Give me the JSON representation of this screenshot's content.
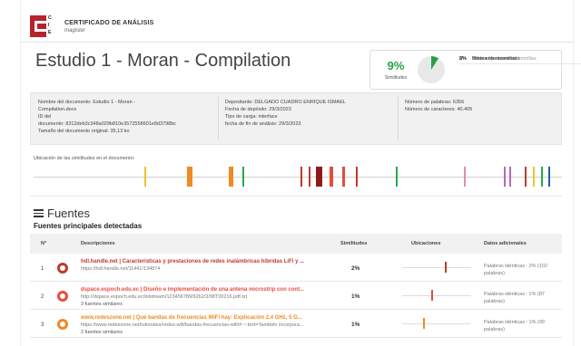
{
  "header": {
    "logo_letters": [
      "C",
      "I",
      "E"
    ],
    "title": "CERTIFICADO DE ANÁLISIS",
    "subtitle": "magister"
  },
  "document_title": "Estudio 1 - Moran - Compilation",
  "similarity": {
    "percent": "9%",
    "percent_value": 9,
    "label": "Similitudes",
    "legend": [
      {
        "pct": "5%",
        "label": "Texto entre comillas"
      },
      {
        "pct": "",
        "label": "0%  similitudes entre comillas"
      },
      {
        "pct": "2%",
        "label": "Idioma no reconocido"
      }
    ]
  },
  "meta": {
    "col1": [
      "Nombre del documento: Estudio 1 - Moran -",
      "Compilation.docx",
      "ID del",
      "documento: 8312deb3c348a029b810e3572558601e8d3798bc",
      "Tamaño del documento original: 35,13 ko"
    ],
    "col2": [
      "Depositante: DELGADO CUADRO ENRIQUE ISMAEL",
      "Fecha de depósito: 29/3/2023",
      "Tipo de carga: interface",
      "fecha de fin de análisis: 29/3/2023"
    ],
    "col3": [
      "Número de palabras: 6356",
      "Número de caracteres: 40.405"
    ]
  },
  "location_label": "Ubicación de las similitudes en el documento:",
  "location_marks": [
    {
      "pos": 0.21,
      "w": 2,
      "color": "#f2c12e"
    },
    {
      "pos": 0.29,
      "w": 6,
      "color": "#f08a24"
    },
    {
      "pos": 0.37,
      "w": 5,
      "color": "#f08a24"
    },
    {
      "pos": 0.395,
      "w": 2,
      "color": "#2aa84a"
    },
    {
      "pos": 0.505,
      "w": 2,
      "color": "#c0392b"
    },
    {
      "pos": 0.52,
      "w": 2,
      "color": "#c0392b"
    },
    {
      "pos": 0.535,
      "w": 7,
      "color": "#8e1b1b"
    },
    {
      "pos": 0.56,
      "w": 4,
      "color": "#e74c3c"
    },
    {
      "pos": 0.585,
      "w": 3,
      "color": "#e74c3c"
    },
    {
      "pos": 0.61,
      "w": 2,
      "color": "#c0392b"
    },
    {
      "pos": 0.685,
      "w": 2,
      "color": "#2aa84a"
    },
    {
      "pos": 0.815,
      "w": 2,
      "color": "#e08fa0"
    },
    {
      "pos": 0.89,
      "w": 2,
      "color": "#b06bb5"
    },
    {
      "pos": 0.9,
      "w": 2,
      "color": "#b06bb5"
    },
    {
      "pos": 0.93,
      "w": 2,
      "color": "#c0392b"
    },
    {
      "pos": 0.945,
      "w": 2,
      "color": "#f2c12e"
    },
    {
      "pos": 0.96,
      "w": 2,
      "color": "#2aa84a"
    },
    {
      "pos": 0.975,
      "w": 2,
      "color": "#1f5fa8"
    }
  ],
  "sources": {
    "title": "Fuentes",
    "subtitle": "Fuentes principales detectadas",
    "columns": [
      "N°",
      "Descripciones",
      "Similitudes",
      "Ubicaciones",
      "Datos adicionales"
    ],
    "rows": [
      {
        "num": "1",
        "color": "#c0392b",
        "title": "hdl.handle.net | Características y prestaciones de redes inalámbricas híbridas LiFi y ...",
        "url": "https://hdl.handle.net/11441/134874",
        "similar": "",
        "pct": "2%",
        "tick_pos": 0.62,
        "tick_color": "#c0392b",
        "extra": "Palabras idénticas : 2% (102 palabras)"
      },
      {
        "num": "2",
        "color": "#e74c3c",
        "title": "dspace.espoch.edu.ec | Diseño e implementación de una antena microstrip con cont...",
        "url": "http://dspace.espoch.edu.ec/bitstream/123456789/9262/3/98T00216.pdf.txt",
        "similar": "3 fuentes similares",
        "pct": "1%",
        "tick_pos": 0.42,
        "tick_color": "#e74c3c",
        "extra": "Palabras idénticas : 1% (87 palabras)"
      },
      {
        "num": "3",
        "color": "#f08a24",
        "title": "www.redeszone.net | Qué bandas de frecuencias WiFi hay: Explicación 2.4 GHz, 5 G...",
        "url": "https://www.redeszone.net/tutoriales/redes-wifi/bandas-frecuencias-wifi/#:~:text=También incorpora...",
        "similar": "2 fuentes similares",
        "pct": "1%",
        "tick_pos": 0.3,
        "tick_color": "#f08a24",
        "extra": "Palabras idénticas : 1% (99 palabras)"
      }
    ]
  }
}
